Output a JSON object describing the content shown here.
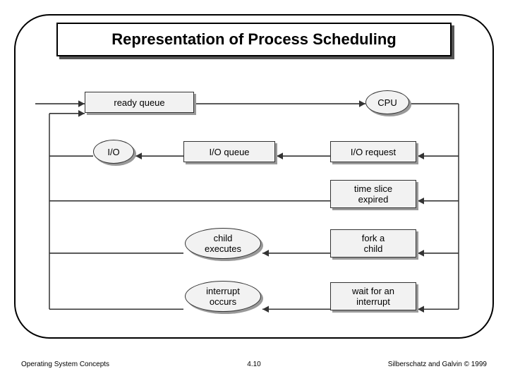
{
  "title": "Representation of Process Scheduling",
  "nodes": {
    "ready_queue": "ready queue",
    "cpu": "CPU",
    "io": "I/O",
    "io_queue": "I/O queue",
    "io_request": "I/O request",
    "time_slice": "time slice\nexpired",
    "child_exec": "child\nexecutes",
    "fork_child": "fork a\nchild",
    "interrupt_occurs": "interrupt\noccurs",
    "wait_interrupt": "wait for an\ninterrupt"
  },
  "footer": {
    "left": "Operating System Concepts",
    "center": "4.10",
    "right": "Silberschatz and Galvin © 1999"
  }
}
